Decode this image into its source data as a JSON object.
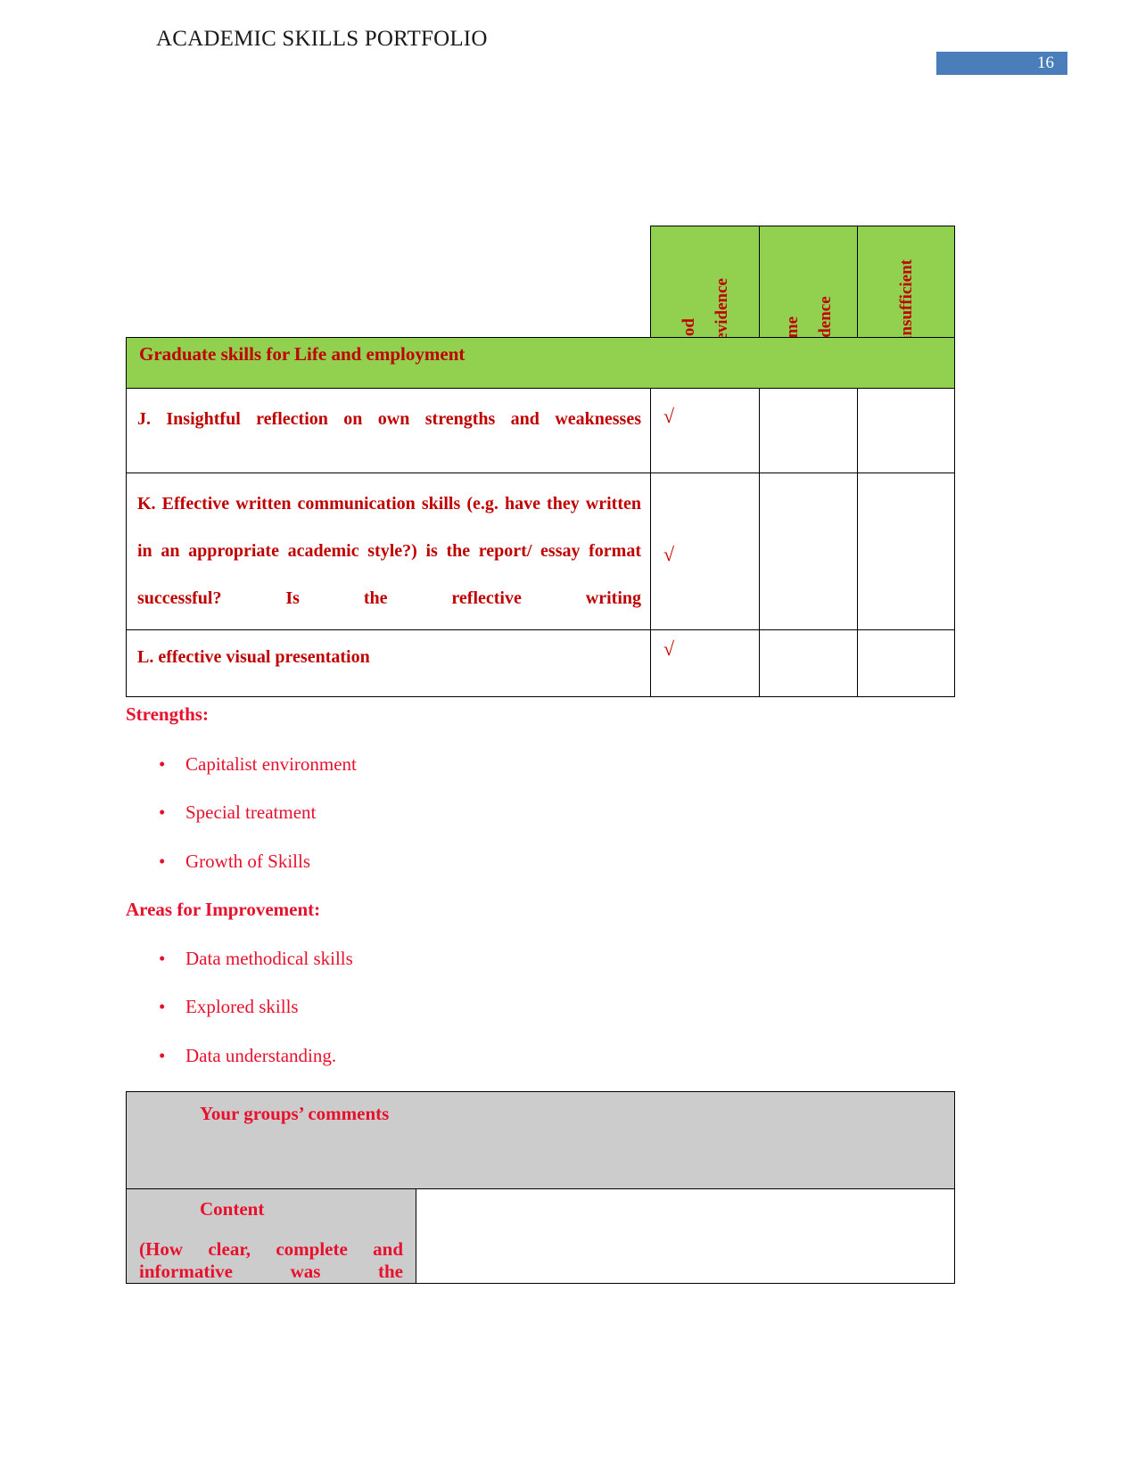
{
  "header": {
    "title": "ACADEMIC SKILLS PORTFOLIO",
    "page_number": "16",
    "badge_color": "#4a7ebb"
  },
  "rating_table": {
    "header_bg": "#92d050",
    "text_color": "#c00000",
    "column_headers": [
      {
        "label": "good",
        "secondary": "evidence"
      },
      {
        "label": "some",
        "secondary": "evidence"
      },
      {
        "label": "insufficient",
        "secondary": ""
      }
    ],
    "section_title": "Graduate skills for Life and employment",
    "rows": [
      {
        "criterion": "J. Insightful reflection on own strengths and weaknesses",
        "good": "√",
        "some": "",
        "insufficient": ""
      },
      {
        "criterion": "K. Effective written communication skills (e.g. have they written in an appropriate academic style?) is the report/ essay format successful? Is the reflective writing",
        "good": "√",
        "some": "",
        "insufficient": ""
      },
      {
        "criterion": "L. effective visual presentation",
        "good": "√",
        "some": "",
        "insufficient": ""
      }
    ]
  },
  "strengths": {
    "heading": "Strengths:",
    "items": [
      "Capitalist environment",
      "Special treatment",
      "Growth of Skills"
    ]
  },
  "improvements": {
    "heading": "Areas for Improvement:",
    "items": [
      "Data methodical skills",
      "Explored skills",
      "Data understanding."
    ]
  },
  "comments_table": {
    "bg": "#cccccc",
    "header": "Your groups’ comments",
    "rows": [
      {
        "label_title": "Content",
        "label_sub": "(How clear, complete and informative was the",
        "value": ""
      }
    ]
  },
  "bullet_glyph": "•"
}
